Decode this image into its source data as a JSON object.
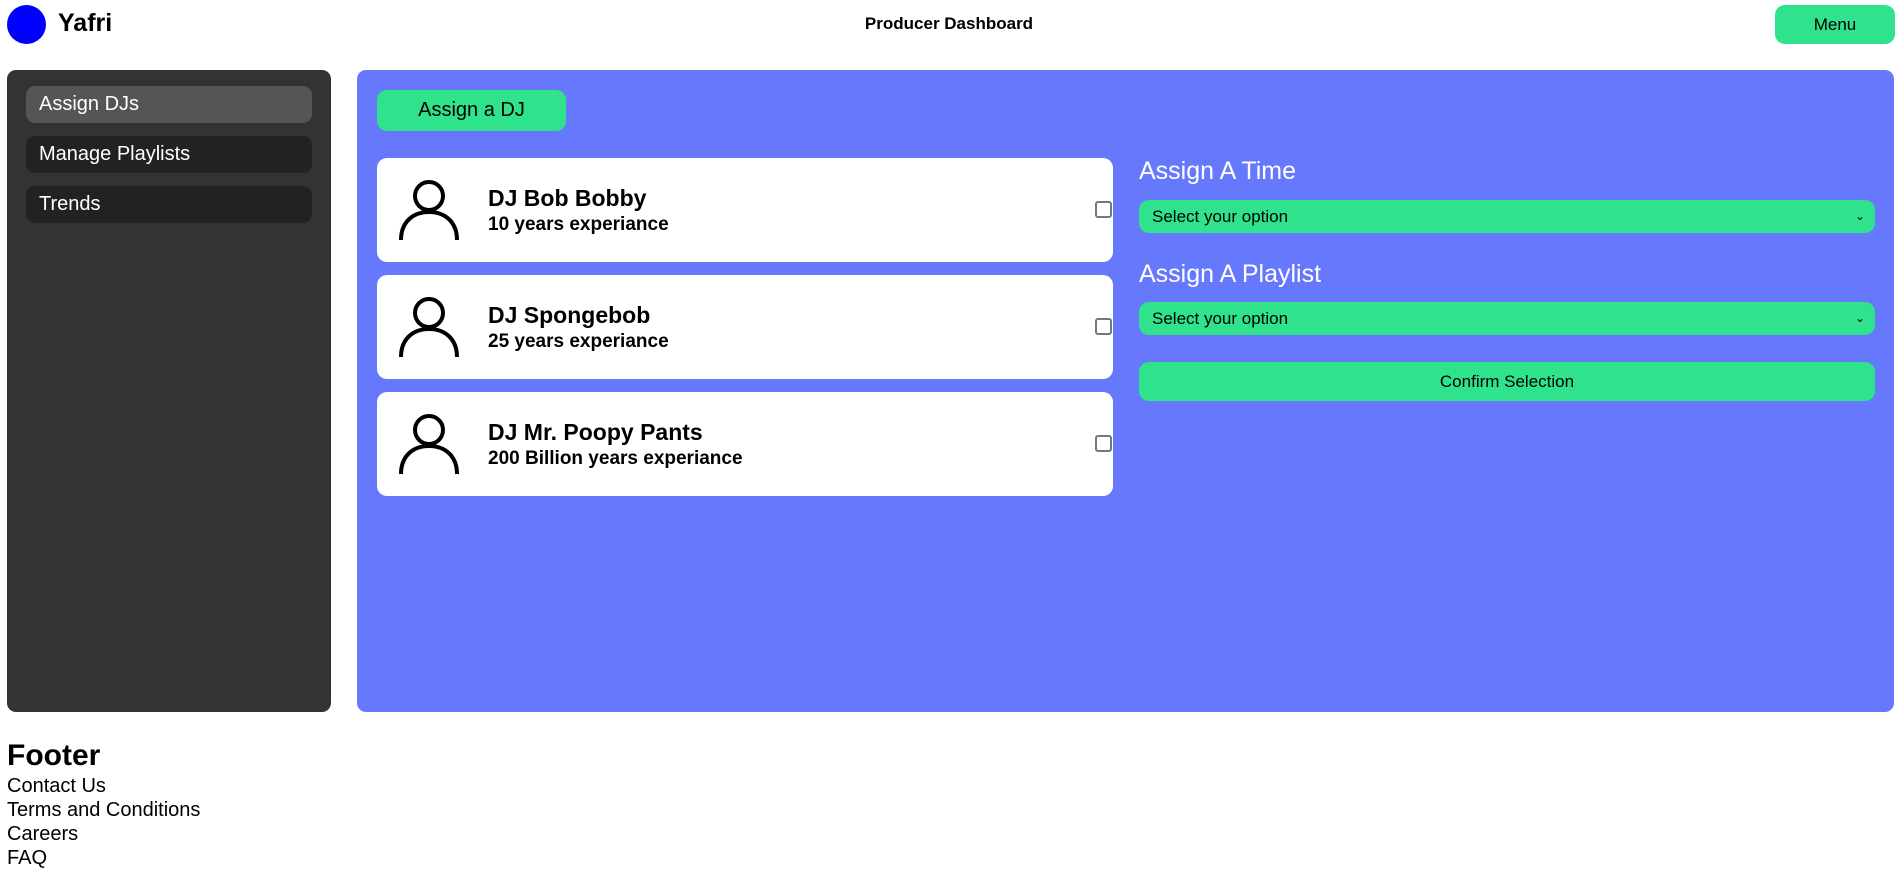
{
  "header": {
    "brand": "Yafri",
    "title": "Producer Dashboard",
    "menu_label": "Menu",
    "logo_color": "#0000ff"
  },
  "sidebar": {
    "items": [
      {
        "label": "Assign DJs",
        "active": true
      },
      {
        "label": "Manage Playlists",
        "active": false
      },
      {
        "label": "Trends",
        "active": false
      }
    ]
  },
  "main": {
    "assign_button_label": "Assign a DJ",
    "djs": [
      {
        "name": "DJ Bob Bobby",
        "experience": "10 years experiance",
        "checked": false,
        "icon": "person-icon"
      },
      {
        "name": "DJ Spongebob",
        "experience": "25 years experiance",
        "checked": false,
        "icon": "person-icon"
      },
      {
        "name": "DJ Mr. Poopy Pants",
        "experience": "200 Billion years experiance",
        "checked": false,
        "icon": "person-icon"
      }
    ],
    "time_label": "Assign A Time",
    "time_select": "Select your option",
    "playlist_label": "Assign A Playlist",
    "playlist_select": "Select your option",
    "confirm_label": "Confirm Selection"
  },
  "footer": {
    "title": "Footer",
    "links": [
      "Contact Us",
      "Terms and Conditions",
      "Careers",
      "FAQ"
    ]
  },
  "colors": {
    "accent": "#2ee38c",
    "main_panel": "#6679fd",
    "sidebar": "#333333",
    "sidebar_item": "#222222",
    "sidebar_item_active": "#555555"
  }
}
